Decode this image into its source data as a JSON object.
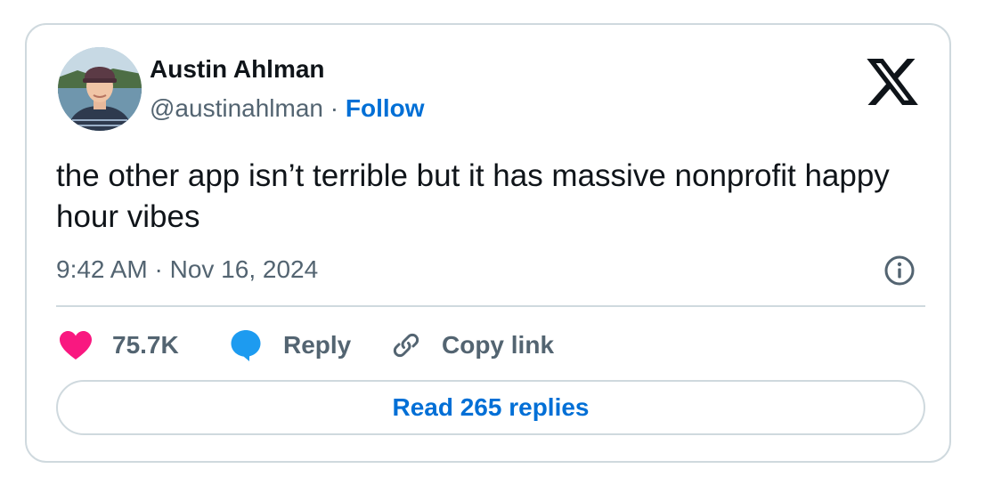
{
  "author": {
    "name": "Austin Ahlman",
    "handle": "@austinahlman",
    "separator": "·",
    "follow_label": "Follow",
    "avatar_icon": "profile-photo"
  },
  "brand": {
    "logo_icon": "x-logo-icon"
  },
  "tweet": {
    "text": "the other app isn’t terrible but it has massive nonprofit happy hour vibes",
    "timestamp": "9:42 AM · Nov 16, 2024"
  },
  "actions": {
    "like_count": "75.7K",
    "reply_label": "Reply",
    "copy_link_label": "Copy link"
  },
  "footer": {
    "read_replies_label": "Read 265 replies"
  },
  "colors": {
    "link_blue": "#006fd6",
    "heart_pink": "#f91880",
    "reply_blue": "#1d9bf0",
    "text_primary": "#0f1419",
    "text_secondary": "#536471",
    "border": "#cfd9de"
  }
}
